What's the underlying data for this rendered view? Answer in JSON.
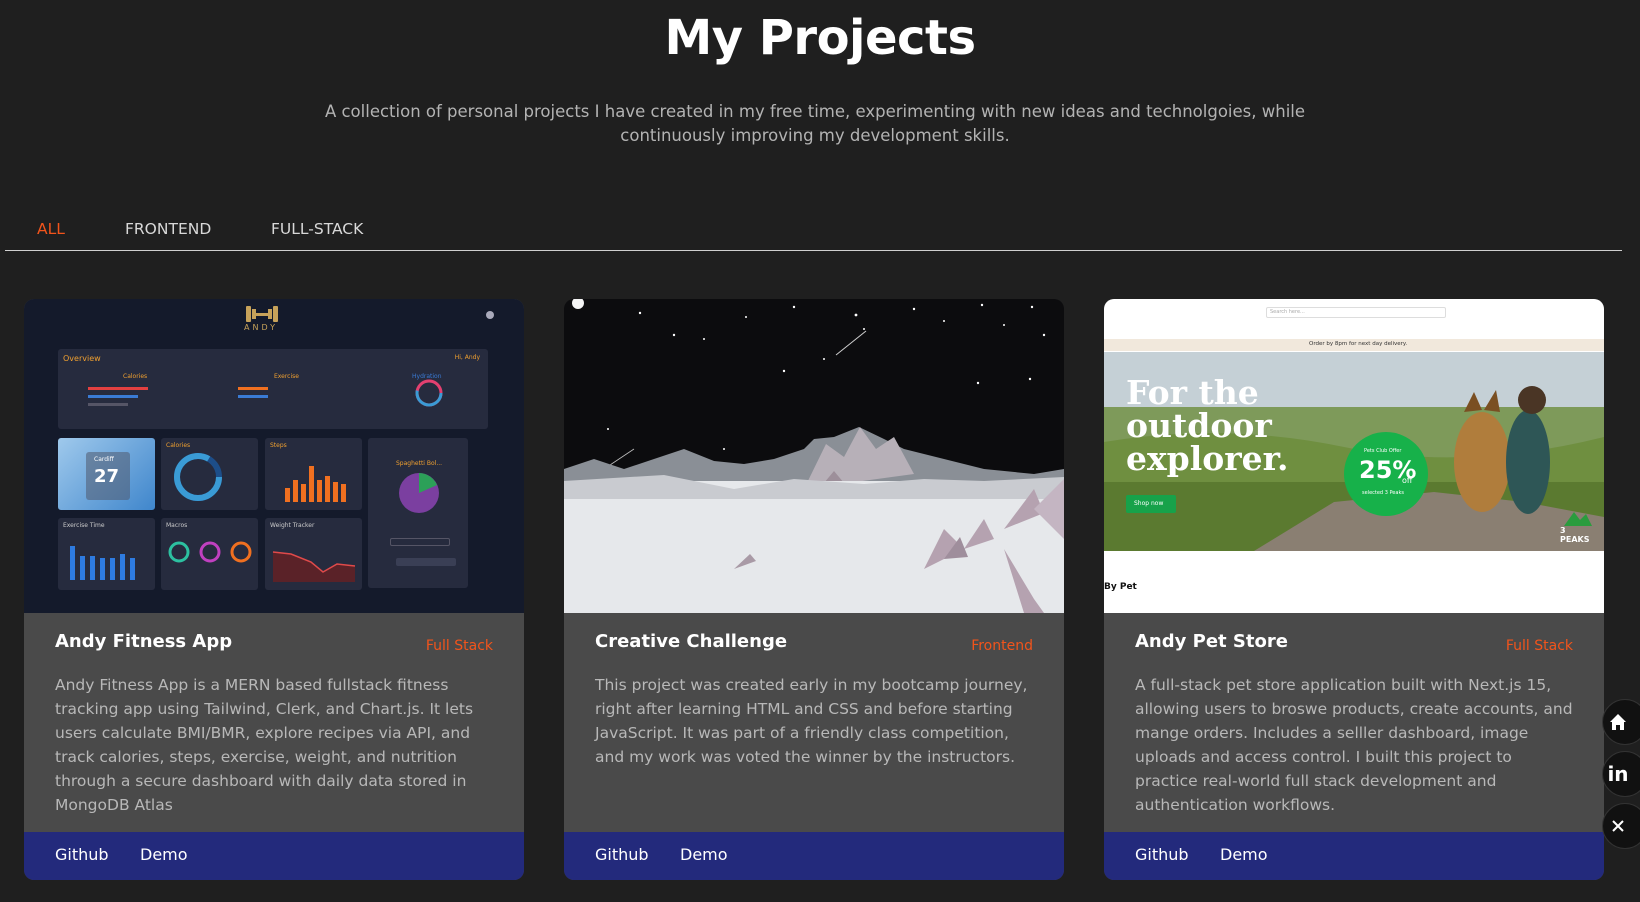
{
  "header": {
    "title": "My Projects",
    "subtitle": "A collection of personal projects I have created in my free time, experimenting with new ideas and technolgoies, while continuously improving my development skills."
  },
  "filters": {
    "tabs": [
      {
        "label": "ALL",
        "active": true
      },
      {
        "label": "FRONTEND",
        "active": false
      },
      {
        "label": "FULL-STACK",
        "active": false
      }
    ]
  },
  "colors": {
    "background": "#1f1f1f",
    "accent": "#f2541b",
    "card_body": "#4a4a4a",
    "card_footer": "#232a7c"
  },
  "projects": [
    {
      "title": "Andy Fitness App",
      "badge": "Full Stack",
      "description": "Andy Fitness App is a MERN based fullstack fitness tracking app using Tailwind, Clerk, and Chart.js. It lets users calculate BMI/BMR, explore recipes via API, and track calories, steps, exercise, weight, and nutrition through a secure dashboard with daily data stored in MongoDB Atlas",
      "github_label": "Github",
      "demo_label": "Demo",
      "thumbnail": {
        "brand": "ANDY",
        "overview": "Overview",
        "greeting": "Hi, Andy",
        "sections": [
          "Calories",
          "Exercise",
          "Hydration"
        ],
        "weather_temp": "27",
        "weather_city": "Cardiff",
        "panels": [
          "Calories",
          "Steps",
          "Exercise Time",
          "Macros",
          "Weight Tracker"
        ],
        "recipe": "Spaghetti Bol..."
      }
    },
    {
      "title": "Creative Challenge",
      "badge": "Frontend",
      "description": "This project was created early in my bootcamp journey, right after learning HTML and CSS and before starting JavaScript. It was part of a friendly class competition, and my work was voted the winner by the instructors.",
      "github_label": "Github",
      "demo_label": "Demo"
    },
    {
      "title": "Andy Pet Store",
      "badge": "Full Stack",
      "description": "A full-stack pet store application built with Next.js 15, allowing users to broswe products, create accounts, and mange orders. Includes a selller dashboard, image uploads and access control. I built this project to practice real-world full stack development and authentication workflows.",
      "github_label": "Github",
      "demo_label": "Demo",
      "thumbnail": {
        "search_placeholder": "Search here...",
        "announcement": "Order by 8pm for next day delivery.",
        "hero_line1": "For the",
        "hero_line2": "outdoor",
        "hero_line3": "explorer.",
        "shop_button": "Shop now",
        "offer_top": "Pets Club Offer",
        "offer_pct": "25%",
        "offer_off": "off",
        "offer_bottom": "selected 3 Peaks",
        "brand_badge": "3 PEAKS",
        "footer_text": "By Pet"
      }
    }
  ],
  "floating_actions": [
    {
      "name": "home",
      "icon": "home-icon"
    },
    {
      "name": "linkedin",
      "icon": "linkedin-icon",
      "label": "in"
    },
    {
      "name": "close",
      "icon": "close-icon"
    }
  ]
}
